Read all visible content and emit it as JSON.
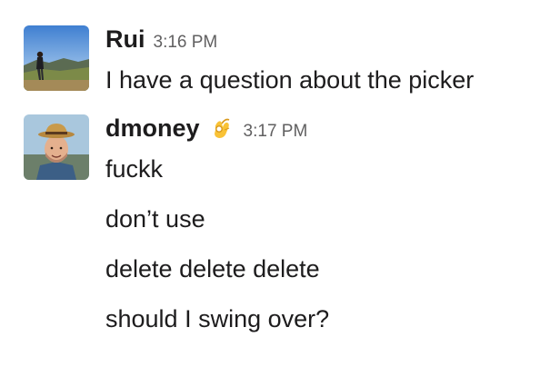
{
  "messages": [
    {
      "sender": "Rui",
      "timestamp": "3:16 PM",
      "lines": [
        "I have a question about the picker"
      ]
    },
    {
      "sender": "dmoney",
      "status_emoji": "ok-hand-emoji",
      "timestamp": "3:17 PM",
      "lines": [
        "fuckk",
        "don’t use",
        "delete delete delete",
        "should I swing over?"
      ]
    }
  ],
  "colors": {
    "sender_text": "#1d1c1d",
    "timestamp_text": "#616061",
    "background": "#ffffff"
  }
}
